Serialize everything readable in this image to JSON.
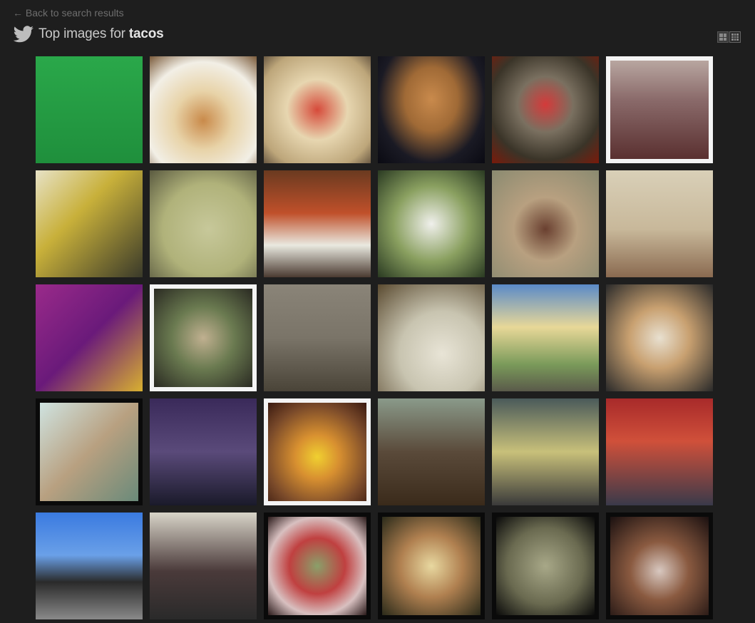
{
  "nav": {
    "back_label": "← Back to search results"
  },
  "header": {
    "title_prefix": "Top images for ",
    "query": "tacos"
  },
  "view_toggle": {
    "options": [
      "large-grid-icon",
      "small-grid-icon"
    ]
  },
  "images": [
    {
      "bg": "linear-gradient(180deg,#2aa84a 0%,#1f8f3c 100%)",
      "frame": "none"
    },
    {
      "bg": "radial-gradient(circle at 50% 60%,#c98a4a 0%,#e8d3a8 35%,#f2efe6 70%,#7a5a3a 100%)",
      "frame": "none"
    },
    {
      "bg": "radial-gradient(circle at 50% 50%,#d64a3a 0%,#e7d6b0 40%,#bda67a 80%,#6b5a44 100%)",
      "frame": "none"
    },
    {
      "bg": "radial-gradient(ellipse at 50% 40%,#c98a4c 0%,#a06a36 35%,#1a1a24 70%,#0a0a12 100%)",
      "frame": "none"
    },
    {
      "bg": "radial-gradient(circle at 50% 45%,#d43a3a 0%,#7a7060 35%,#3a3428 70%,#7a1a0a 100%)",
      "frame": "none"
    },
    {
      "bg": "linear-gradient(180deg,#b8a6a0 0%,#8a6a6a 40%,#5a3030 100%)",
      "frame": "white"
    },
    {
      "bg": "linear-gradient(135deg,#e7e2c6 0%,#c8b03a 40%,#3a3a2a 100%)",
      "frame": "none"
    },
    {
      "bg": "radial-gradient(circle at 55% 55%,#c7c89a 0%,#b0b27a 55%,#5a5a40 100%)",
      "frame": "none"
    },
    {
      "bg": "linear-gradient(180deg,#6a3a20 0%,#c0502a 40%,#e9e9e0 70%,#4a3a30 100%)",
      "frame": "none"
    },
    {
      "bg": "radial-gradient(circle at 50% 50%,#f0f0ec 0%,#8aa060 50%,#2a3a22 100%)",
      "frame": "none"
    },
    {
      "bg": "radial-gradient(circle at 50% 55%,#6a4030 0%,#b8a080 40%,#8a8a70 100%)",
      "frame": "none"
    },
    {
      "bg": "linear-gradient(180deg,#d9d0b8 0%,#c8b89a 55%,#8a6a50 100%)",
      "frame": "none"
    },
    {
      "bg": "linear-gradient(135deg,#9a2a8a 0%,#6a1a7a 50%,#d8b030 100%)",
      "frame": "none"
    },
    {
      "bg": "radial-gradient(circle at 50% 50%,#c0b090 0%,#6a7a50 45%,#2a2a22 100%)",
      "frame": "white"
    },
    {
      "bg": "linear-gradient(180deg,#8a8478 0%,#7a7468 50%,#4a4438 100%)",
      "frame": "none"
    },
    {
      "bg": "radial-gradient(circle at 60% 65%,#e8e4d6 0%,#c8c4b0 45%,#5a4a30 100%)",
      "frame": "none"
    },
    {
      "bg": "linear-gradient(180deg,#5a8ac8 0%,#e8d898 40%,#7a9a5a 75%,#5a5a4a 100%)",
      "frame": "none"
    },
    {
      "bg": "radial-gradient(circle at 50% 50%,#e8e0d0 0%,#c8a070 40%,#2a2a2a 100%)",
      "frame": "none"
    },
    {
      "bg": "linear-gradient(135deg,#cfe3e0 0%,#b8a080 50%,#6a8a7a 100%)",
      "frame": "black"
    },
    {
      "bg": "linear-gradient(180deg,#3a2a5a 0%,#5a4a7a 50%,#1a1a2a 100%)",
      "frame": "none"
    },
    {
      "bg": "radial-gradient(circle at 50% 55%,#f0d030 0%,#d89030 30%,#7a4a2a 70%,#3a1a10 100%)",
      "frame": "white"
    },
    {
      "bg": "linear-gradient(180deg,#8a9a8a 0%,#5a4a3a 50%,#3a2a1a 100%)",
      "frame": "none"
    },
    {
      "bg": "linear-gradient(180deg,#4a5a5a 0%,#c8c07a 50%,#3a3a3a 100%)",
      "frame": "none"
    },
    {
      "bg": "linear-gradient(180deg,#a82a2a 0%,#d0503a 40%,#3a3a4a 100%)",
      "frame": "none"
    },
    {
      "bg": "linear-gradient(180deg,#3a7ae0 0%,#6aa0e8 40%,#2a2a2a 65%,#8a8a8a 100%)",
      "frame": "none"
    },
    {
      "bg": "linear-gradient(180deg,#d8d4c8 0%,#4a3a3a 55%,#2a2a2a 100%)",
      "frame": "none"
    },
    {
      "bg": "radial-gradient(circle at 50% 50%,#8aa06a 0%,#c04040 40%,#d8c0c0 70%,#2a1a1a 100%)",
      "frame": "black"
    },
    {
      "bg": "radial-gradient(circle at 50% 50%,#e8d8a0 0%,#b08050 45%,#2a2a1a 100%)",
      "frame": "black"
    },
    {
      "bg": "radial-gradient(circle at 50% 50%,#a8a888 0%,#6a6a50 55%,#0a0a0a 100%)",
      "frame": "black"
    },
    {
      "bg": "radial-gradient(circle at 50% 55%,#d8c8c0 0%,#8a5a40 40%,#1a1010 100%)",
      "frame": "black"
    }
  ]
}
